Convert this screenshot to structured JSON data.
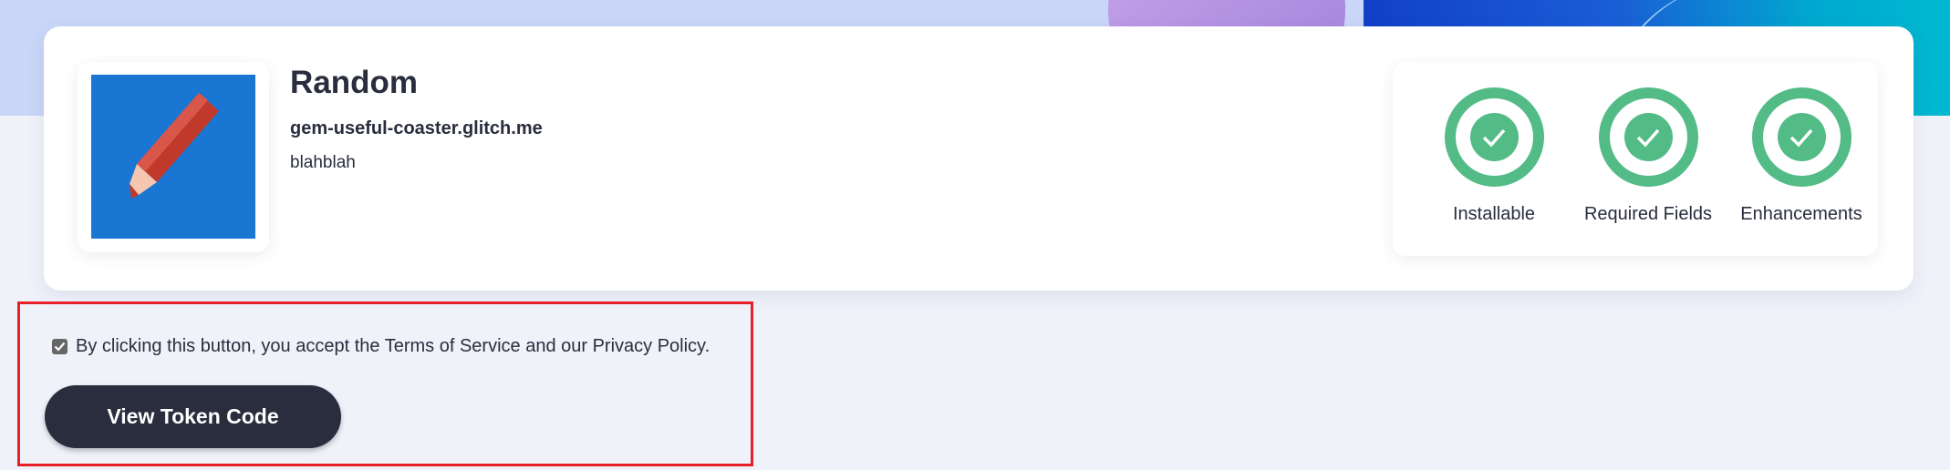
{
  "app": {
    "name": "Random",
    "url": "gem-useful-coaster.glitch.me",
    "description": "blahblah",
    "icon": "pencil-icon"
  },
  "stats": [
    {
      "label": "Installable",
      "status": "check"
    },
    {
      "label": "Required Fields",
      "status": "check"
    },
    {
      "label": "Enhancements",
      "status": "check"
    }
  ],
  "consent": {
    "checked": true,
    "text": "By clicking this button, you accept the Terms of Service and our Privacy Policy."
  },
  "button": {
    "label": "View Token Code"
  },
  "colors": {
    "accent": "#52bb86",
    "button": "#292d3d",
    "highlight": "#e8202a"
  }
}
